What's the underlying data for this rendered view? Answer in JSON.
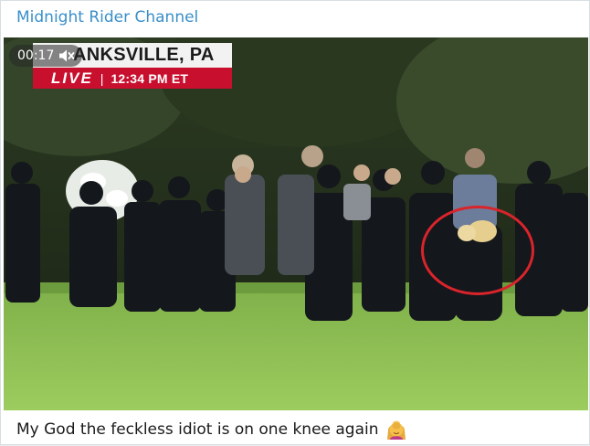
{
  "channel": {
    "name": "Midnight Rider Channel"
  },
  "video": {
    "elapsed": "00:17",
    "sound_icon": "mute-icon",
    "overlay": {
      "location": "ANKSVILLE, PA",
      "live_label": "LIVE",
      "separator": "|",
      "time": "12:34 PM ET"
    },
    "highlight_color": "#d9242b"
  },
  "post": {
    "caption": "My God the feckless idiot is on one knee again",
    "emoji_icon": "woman-facepalming-icon"
  },
  "colors": {
    "channel_name": "#3a8fc9",
    "live_red": "#c8102e"
  }
}
